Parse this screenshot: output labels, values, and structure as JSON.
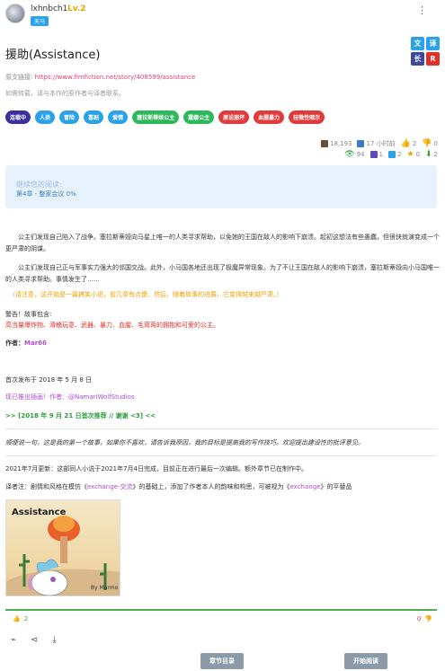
{
  "header": {
    "username": "lxhnbch1",
    "level": "Lv.2",
    "badge": "天马",
    "menu_icon": "kebab-icon"
  },
  "story": {
    "title": "援助(Assistance)",
    "source_label": "原文链接: ",
    "source_url": "https://www.fimfiction.net/story/408599/assistance",
    "note": "如需转载，请与本作的原作者与译者联系。",
    "lang_badges": [
      {
        "label": "文",
        "color": "#2aa1e8"
      },
      {
        "label": "译",
        "color": "#2aa1e8"
      },
      {
        "label": "长",
        "color": "#3b4a9c"
      },
      {
        "label": "R",
        "color": "#e0302a"
      }
    ],
    "tags": [
      {
        "label": "连载中",
        "color": "#3b2fa0"
      },
      {
        "label": "人类",
        "color": "#2aa1e8"
      },
      {
        "label": "冒险",
        "color": "#2aa1e8"
      },
      {
        "label": "喜剧",
        "color": "#2aa1e8"
      },
      {
        "label": "爱情",
        "color": "#2aa1e8"
      },
      {
        "label": "塞拉斯蒂娅公主",
        "color": "#2eb85c"
      },
      {
        "label": "露娜公主",
        "color": "#2eb85c"
      },
      {
        "label": "原设崩坏",
        "color": "#e03a3a"
      },
      {
        "label": "血腥暴力",
        "color": "#e03a3a"
      },
      {
        "label": "轻微性暗示",
        "color": "#e03a3a"
      }
    ]
  },
  "stats": {
    "words": "18,193",
    "time": "17 小时前",
    "likes": "2",
    "dislikes": "0",
    "views": "94",
    "comments": "1",
    "favorites": "2",
    "stars": "0",
    "downloads": "2"
  },
  "progress": {
    "title": "继续您的阅读:",
    "chapter": "第4章 - 整家会议 0%"
  },
  "content": {
    "p1": "公主们发现自己陷入了战争。塞拉斯蒂娅向马星上唯一的人类寻求帮助，以免她的王国在敌人的影响下崩溃。起初这想法有些愚蠢，但很快就演变成一个更严肃的阴谋。",
    "p2": "公主们发现自己正与军事实力强大的邻国交战。此外，小马国各地还出现了极魔异常现象。为了不让王国在敌人的影响下崩溃，塞拉斯蒂娅向小马国唯一的人类寻求帮助。事情发生了……",
    "warning_orange": "（请注意，这开始是一篇搞笑小说，前几章有点傻。然后，随着故事的进展，它变得越来越严肃。）",
    "warning_label": "警告！故事包含:",
    "warning_red": "高当量爆炸物、滑稽玩意、武器、暴力、血腥、毛茸茸的拥抱和可爱的公主。",
    "author_label": "作者：",
    "author_name": "Mar66",
    "published": "首次发布于 2018 年 5 月 8 日",
    "illustration": "现已推出插画！作者：@NamariWolfStudios",
    "featured": ">> [2018 年 9 月 21 日首次推荐 // 谢谢 <3] <<",
    "disclaimer": "顺便说一句，这是我的第一个故事，如果你不喜欢，请告诉我原因，我的目标是提高我的写作技巧。欢迎提出建设性的批评意见。",
    "update": "2021年7月更新：这部同人小说于2021年7月4日完成，目前正在进行最后一次编辑。额外章节已在制作中。",
    "translator_prefix": "译者注：剧情和风格在模仿《",
    "translator_link1": "exchange-交流",
    "translator_mid": "》的基础上，添加了作者本人的韵味和构思，可被视为《",
    "translator_link2": "exchange",
    "translator_suffix": "》的平替品"
  },
  "cover": {
    "title": "Assistance",
    "signature": "By Marmo"
  },
  "footer": {
    "likes": "2",
    "dislikes": "0",
    "toc_button": "章节目录",
    "start_button": "开始阅读"
  }
}
